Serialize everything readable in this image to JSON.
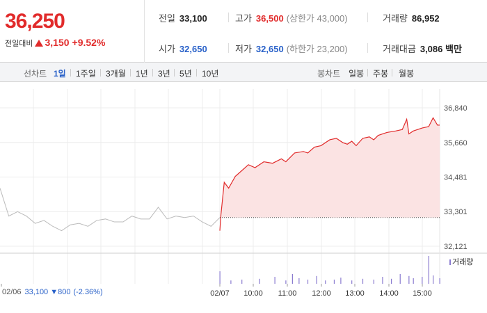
{
  "header": {
    "price": "36,250",
    "change_label": "전일대비",
    "change_value": "3,150",
    "change_pct": "+9.52%",
    "stats": {
      "prev_close_label": "전일",
      "prev_close": "33,100",
      "high_label": "고가",
      "high": "36,500",
      "upper_limit": "(상한가 43,000)",
      "volume_label": "거래량",
      "volume": "86,952",
      "open_label": "시가",
      "open": "32,650",
      "low_label": "저가",
      "low": "32,650",
      "lower_limit": "(하한가 23,200)",
      "trade_value_label": "거래대금",
      "trade_value": "3,086 백만"
    }
  },
  "toolbar": {
    "line_chart_label": "선차트",
    "periods": [
      "1일",
      "1주일",
      "3개월",
      "1년",
      "3년",
      "5년",
      "10년"
    ],
    "active_period": "1일",
    "candle_chart_label": "봉차트",
    "candle_periods": [
      "일봉",
      "주봉",
      "월봉"
    ]
  },
  "colors": {
    "up": "#e12b2b",
    "down": "#2a62c9",
    "prev_line": "#bbbbbb",
    "area_fill": "#fbe3e3"
  },
  "chart_data": {
    "type": "line",
    "y_ticks": [
      "36,840",
      "35,660",
      "34,481",
      "33,301",
      "32,121"
    ],
    "ylim": [
      32121,
      36840
    ],
    "x_labels": [
      "02/06",
      "02/07",
      "10:00",
      "11:00",
      "12:00",
      "13:00",
      "14:00",
      "15:00"
    ],
    "prev_day_caption": {
      "date": "02/06",
      "price": "33,100",
      "change": "800",
      "change_pct": "(-2.36%)"
    },
    "reference_price": 33100,
    "volume_legend": "거래량",
    "series": [
      {
        "name": "02/06",
        "x": [
          0,
          0.04,
          0.08,
          0.12,
          0.16,
          0.2,
          0.24,
          0.28,
          0.32,
          0.36,
          0.4,
          0.44,
          0.48,
          0.52,
          0.56,
          0.6,
          0.64,
          0.68,
          0.72,
          0.76,
          0.8,
          0.84,
          0.88,
          0.92,
          0.96,
          1.0
        ],
        "values": [
          34100,
          33150,
          33300,
          33150,
          32900,
          33000,
          32800,
          32650,
          32850,
          32900,
          32800,
          33000,
          33050,
          32950,
          32950,
          33150,
          33050,
          33050,
          33450,
          33050,
          33150,
          33100,
          33150,
          32950,
          32800,
          33100
        ]
      },
      {
        "name": "02/07",
        "x": [
          0,
          0.005,
          0.02,
          0.04,
          0.07,
          0.1,
          0.13,
          0.16,
          0.2,
          0.24,
          0.28,
          0.3,
          0.34,
          0.38,
          0.4,
          0.43,
          0.46,
          0.5,
          0.53,
          0.56,
          0.58,
          0.6,
          0.62,
          0.65,
          0.68,
          0.7,
          0.72,
          0.76,
          0.8,
          0.83,
          0.85,
          0.86,
          0.88,
          0.92,
          0.95,
          0.97,
          0.99,
          1.0
        ],
        "values": [
          32650,
          33200,
          34300,
          34100,
          34500,
          34700,
          34900,
          34800,
          35000,
          34950,
          35100,
          35000,
          35300,
          35350,
          35300,
          35500,
          35550,
          35750,
          35800,
          35650,
          35600,
          35700,
          35550,
          35800,
          35850,
          35750,
          35900,
          36000,
          36050,
          36100,
          36450,
          35950,
          36050,
          36150,
          36200,
          36500,
          36250,
          36250
        ]
      }
    ],
    "volume_bars": [
      {
        "x": 0.0,
        "v": 0.45
      },
      {
        "x": 0.05,
        "v": 0.12
      },
      {
        "x": 0.1,
        "v": 0.15
      },
      {
        "x": 0.18,
        "v": 0.18
      },
      {
        "x": 0.25,
        "v": 0.25
      },
      {
        "x": 0.3,
        "v": 0.12
      },
      {
        "x": 0.33,
        "v": 0.35
      },
      {
        "x": 0.36,
        "v": 0.2
      },
      {
        "x": 0.4,
        "v": 0.15
      },
      {
        "x": 0.44,
        "v": 0.28
      },
      {
        "x": 0.48,
        "v": 0.12
      },
      {
        "x": 0.52,
        "v": 0.15
      },
      {
        "x": 0.55,
        "v": 0.22
      },
      {
        "x": 0.6,
        "v": 0.12
      },
      {
        "x": 0.65,
        "v": 0.18
      },
      {
        "x": 0.7,
        "v": 0.15
      },
      {
        "x": 0.74,
        "v": 0.25
      },
      {
        "x": 0.78,
        "v": 0.18
      },
      {
        "x": 0.82,
        "v": 0.35
      },
      {
        "x": 0.86,
        "v": 0.28
      },
      {
        "x": 0.88,
        "v": 0.2
      },
      {
        "x": 0.92,
        "v": 0.25
      },
      {
        "x": 0.95,
        "v": 1.0
      },
      {
        "x": 0.97,
        "v": 0.3
      },
      {
        "x": 1.0,
        "v": 0.2
      }
    ]
  }
}
